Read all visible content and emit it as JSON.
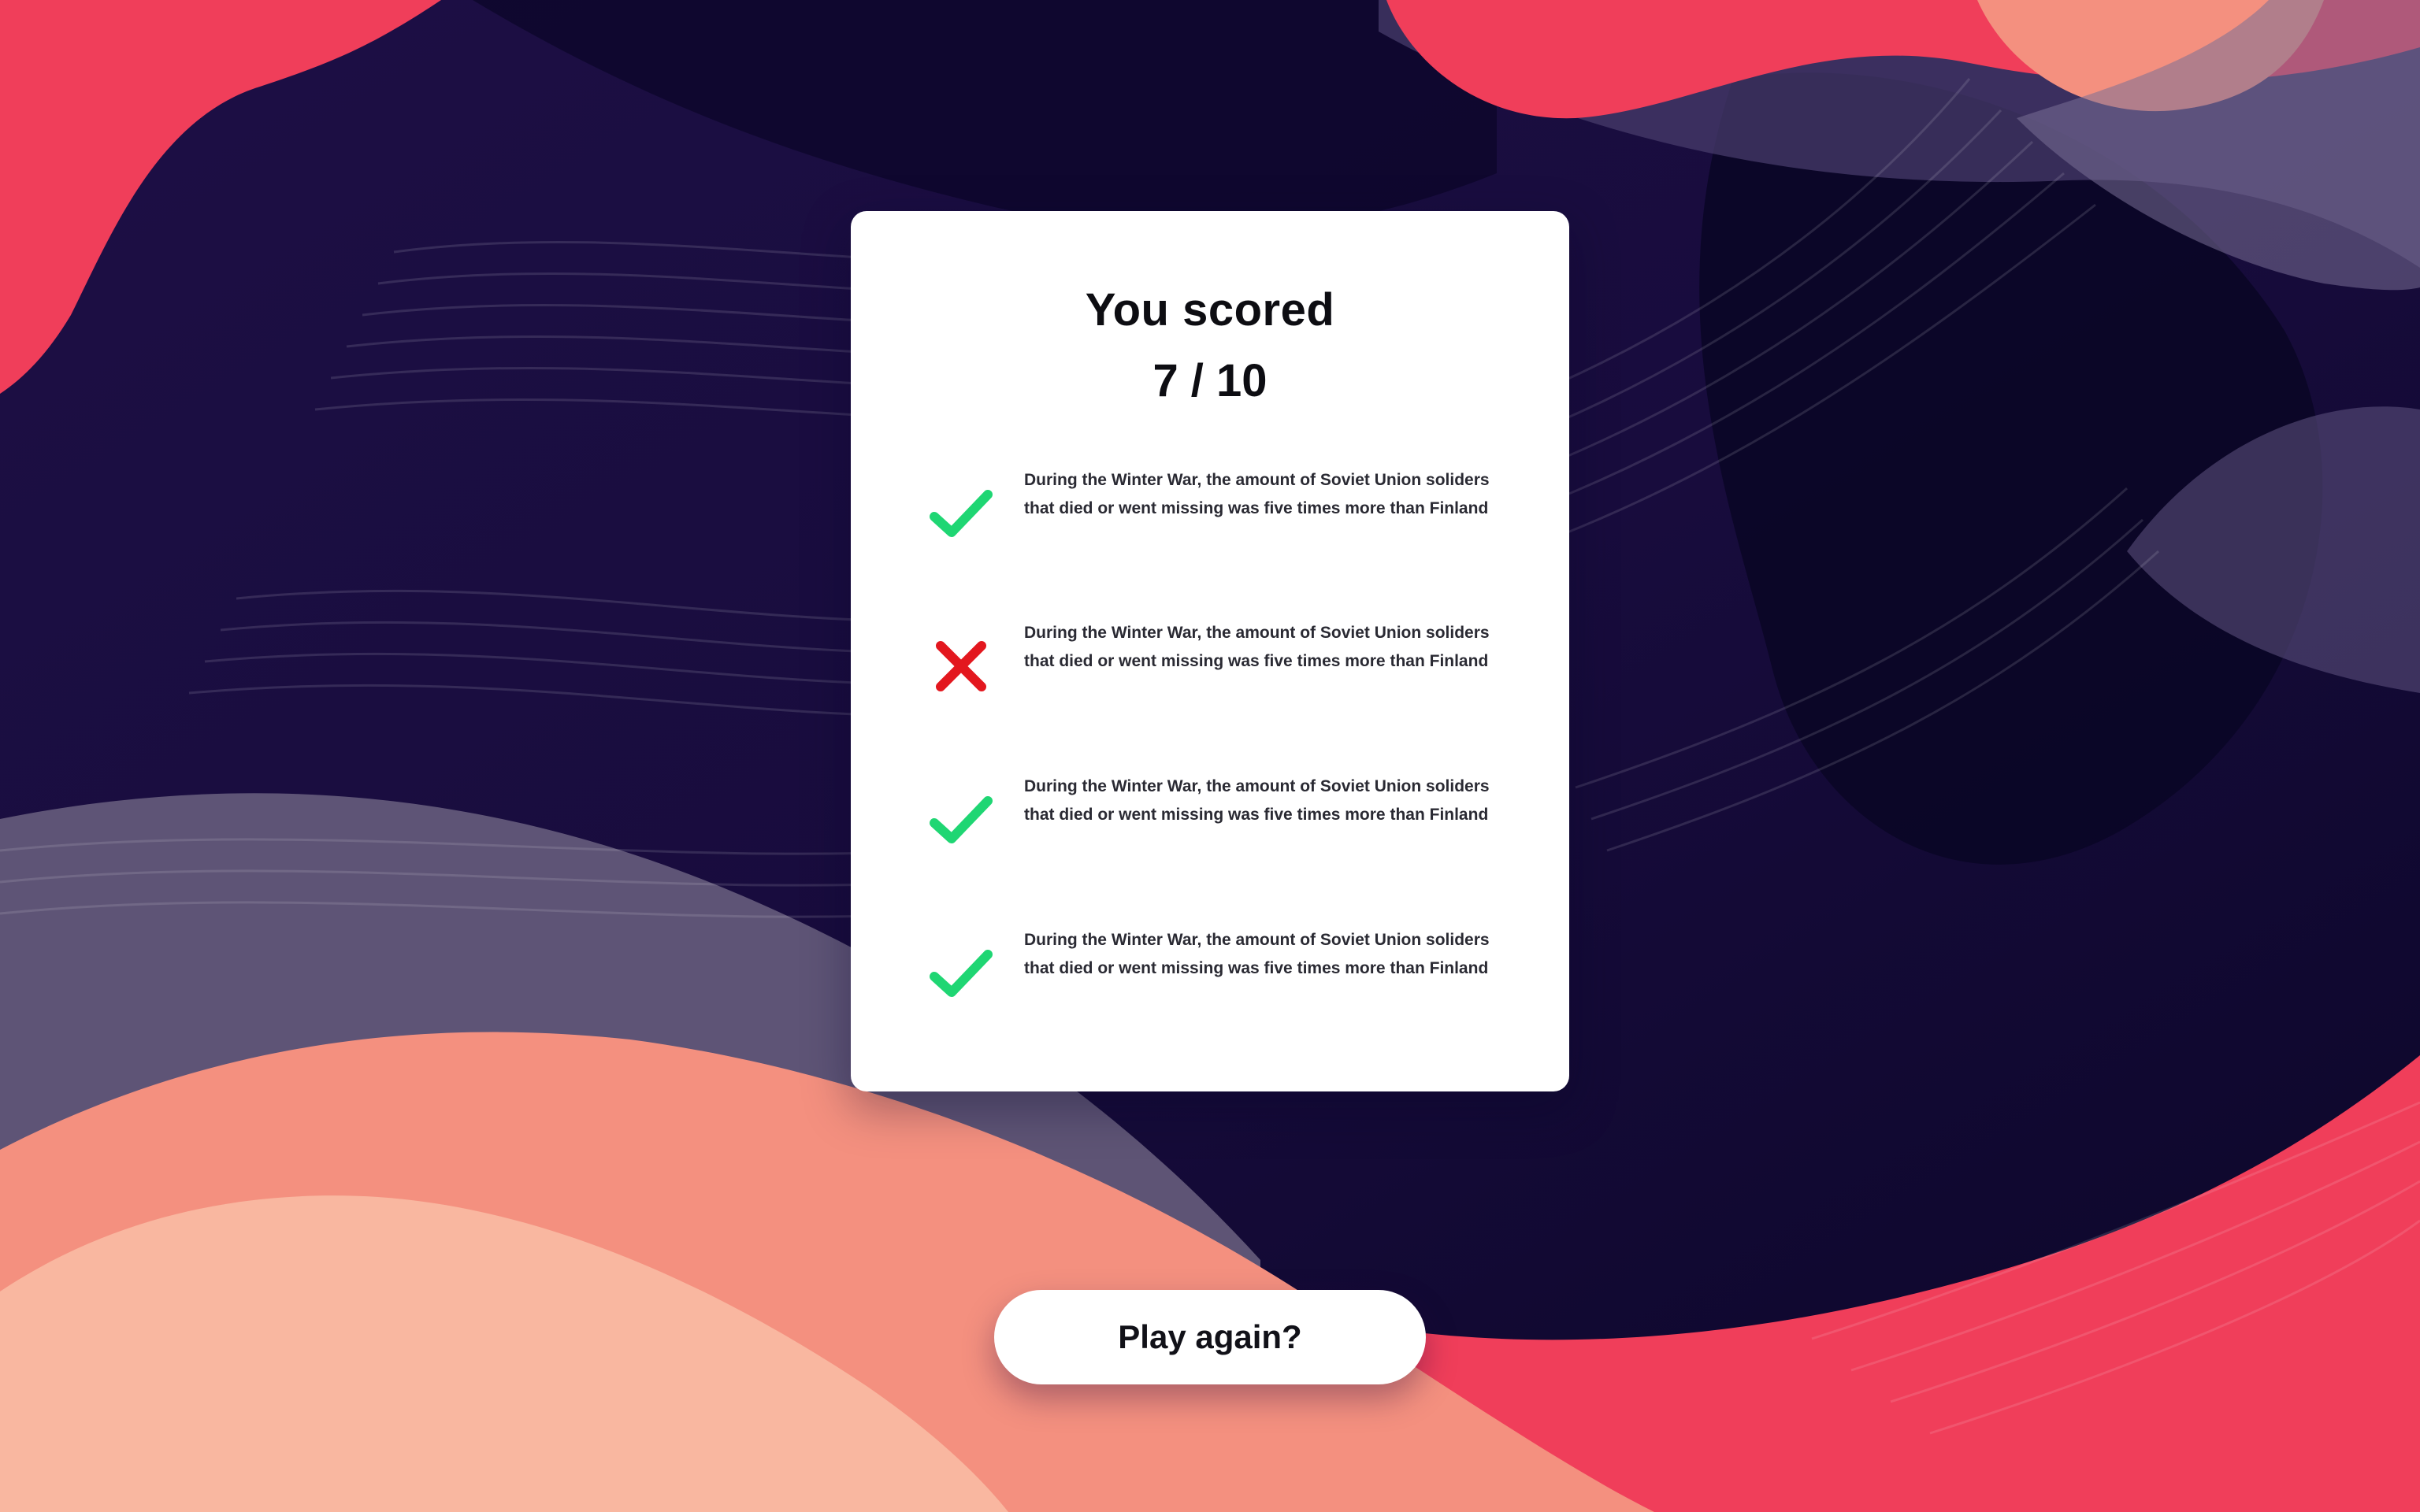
{
  "app": {
    "title": "You scored",
    "score": "7 / 10"
  },
  "colors": {
    "correct": "#1fd673",
    "incorrect": "#e3171e",
    "accent_red": "#f03e5a",
    "accent_salmon": "#f4907f",
    "background_dark": "#140a33"
  },
  "results": [
    {
      "status": "correct",
      "icon": "check-icon",
      "text": "During the Winter War, the amount of Soviet Union soliders that died or went missing was five times more than Finland"
    },
    {
      "status": "incorrect",
      "icon": "cross-icon",
      "text": "During the Winter War, the amount of Soviet Union soliders that died or went missing was five times more than Finland"
    },
    {
      "status": "correct",
      "icon": "check-icon",
      "text": "During the Winter War, the amount of Soviet Union soliders that died or went missing was five times more than Finland"
    },
    {
      "status": "correct",
      "icon": "check-icon",
      "text": "During the Winter War, the amount of Soviet Union soliders that died or went missing was five times more than Finland"
    }
  ],
  "actions": {
    "play_again_label": "Play again?"
  }
}
